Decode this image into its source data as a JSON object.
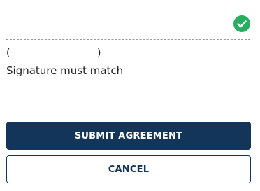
{
  "signature": {
    "value": "",
    "status_icon": "check-circle-icon",
    "status_color": "#27ae60"
  },
  "printed_name": {
    "open": "(",
    "name": "",
    "close": ")"
  },
  "hint": "Signature must match",
  "buttons": {
    "submit_label": "SUBMIT AGREEMENT",
    "cancel_label": "CANCEL"
  },
  "colors": {
    "primary": "#13355a",
    "success": "#27ae60"
  }
}
